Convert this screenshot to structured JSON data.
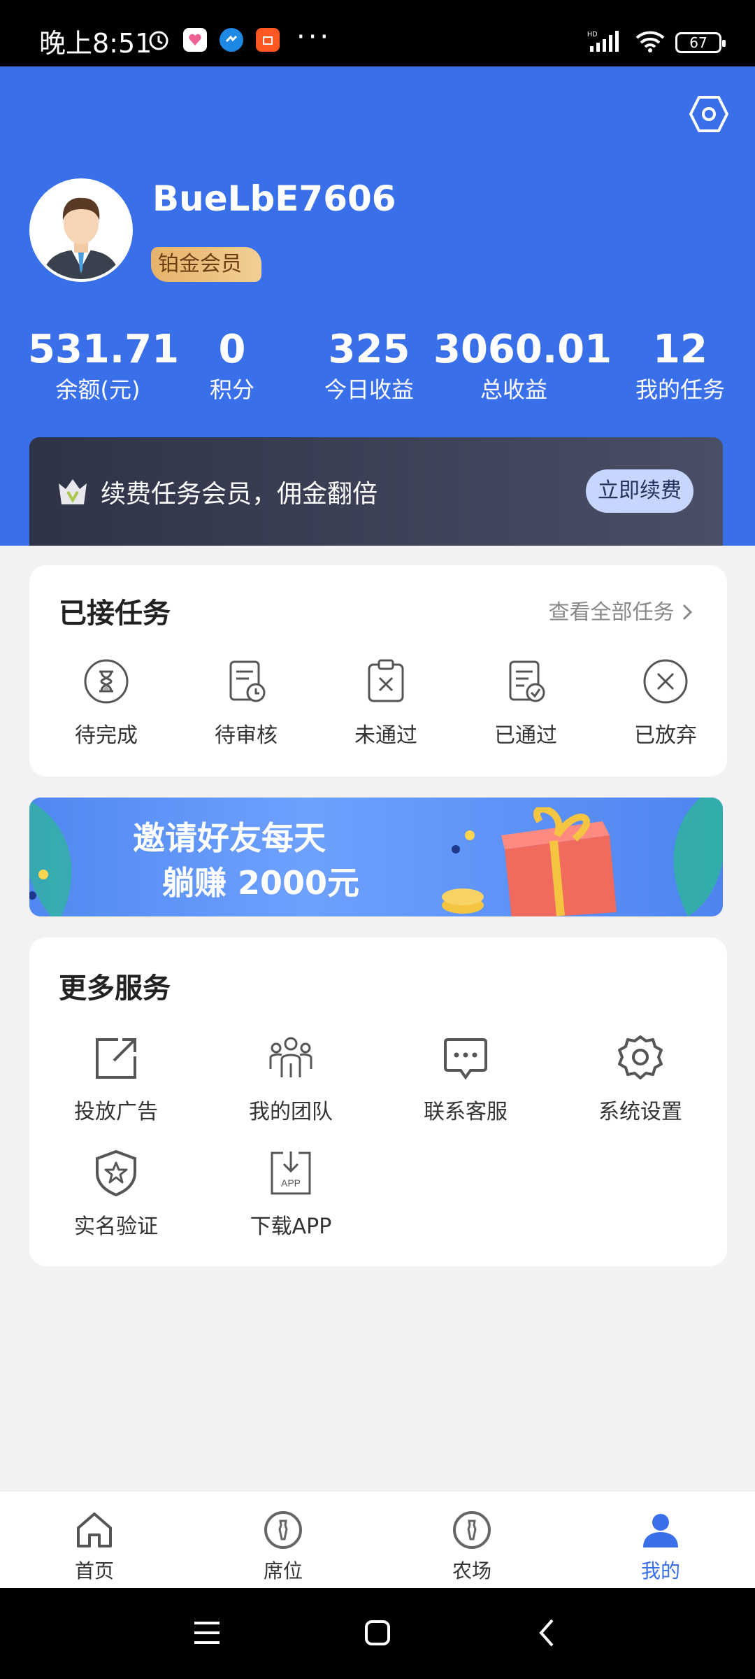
{
  "status_bar": {
    "time": "晚上8:51",
    "battery": "67",
    "network": "HD"
  },
  "profile": {
    "username": "BueLbE7606",
    "badge": "铂金会员"
  },
  "stats": [
    {
      "value": "531.71",
      "label": "余额(元)"
    },
    {
      "value": "0",
      "label": "积分"
    },
    {
      "value": "325",
      "label": "今日收益"
    },
    {
      "value": "3060.01",
      "label": "总收益"
    },
    {
      "value": "12",
      "label": "我的任务"
    }
  ],
  "renew": {
    "text": "续费任务会员，佣金翻倍",
    "button": "立即续费"
  },
  "tasks": {
    "title": "已接任务",
    "view_all": "查看全部任务",
    "items": [
      {
        "label": "待完成",
        "icon": "hourglass-icon"
      },
      {
        "label": "待审核",
        "icon": "review-doc-icon"
      },
      {
        "label": "未通过",
        "icon": "rejected-clipboard-icon"
      },
      {
        "label": "已通过",
        "icon": "approved-doc-icon"
      },
      {
        "label": "已放弃",
        "icon": "cancel-circle-icon"
      }
    ]
  },
  "banner": {
    "line1": "邀请好友每天",
    "line2": "躺赚 2000元"
  },
  "services": {
    "title": "更多服务",
    "items": [
      {
        "label": "投放广告",
        "icon": "external-link-icon"
      },
      {
        "label": "我的团队",
        "icon": "team-icon"
      },
      {
        "label": "联系客服",
        "icon": "chat-icon"
      },
      {
        "label": "系统设置",
        "icon": "gear-icon"
      },
      {
        "label": "实名验证",
        "icon": "shield-star-icon"
      },
      {
        "label": "下载APP",
        "icon": "download-app-icon"
      }
    ],
    "download_icon_text": "APP"
  },
  "bottom_nav": {
    "items": [
      {
        "label": "首页",
        "icon": "home-icon"
      },
      {
        "label": "席位",
        "icon": "seat-icon"
      },
      {
        "label": "农场",
        "icon": "farm-icon"
      },
      {
        "label": "我的",
        "icon": "profile-icon",
        "active": true
      }
    ]
  },
  "colors": {
    "primary": "#3a6fea",
    "badge_gold": "#e6b36b",
    "renew_bg": "#2f3347"
  }
}
